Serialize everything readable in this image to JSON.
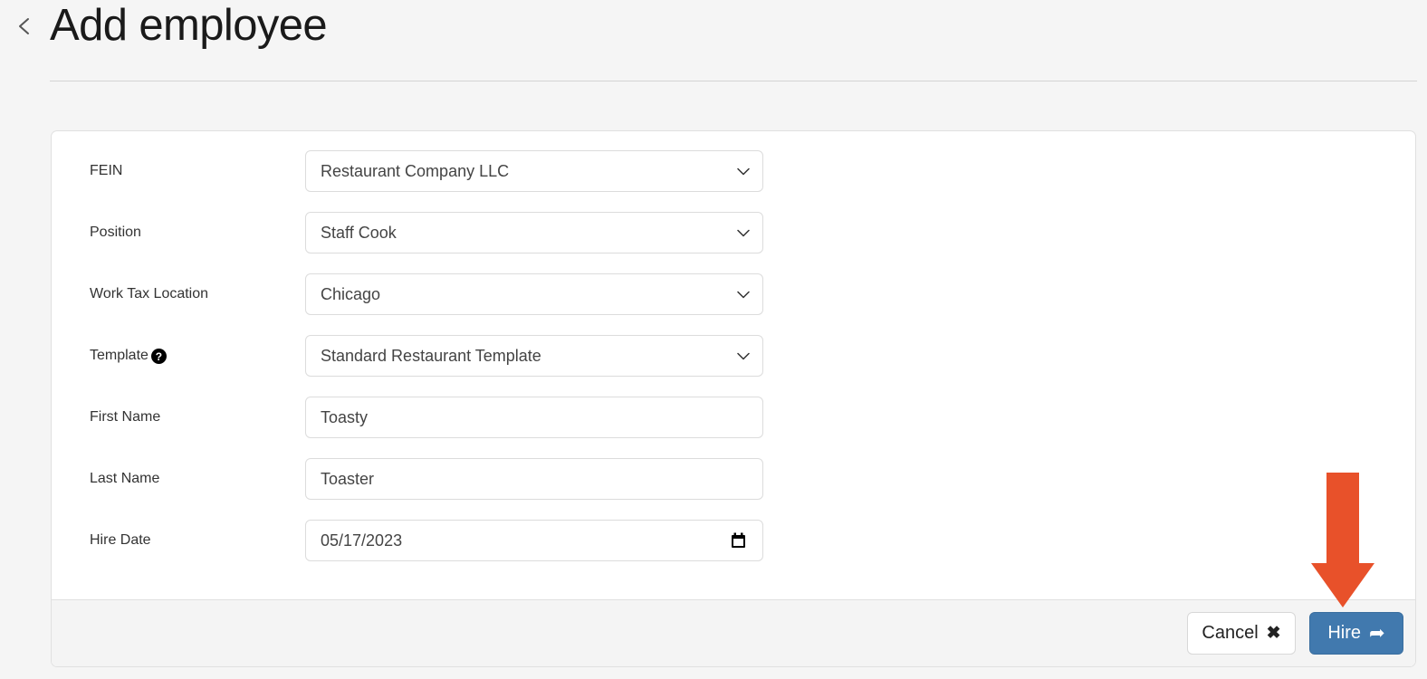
{
  "header": {
    "back_icon": "chevron-left-icon",
    "title": "Add employee"
  },
  "form": {
    "rows": [
      {
        "label": "FEIN",
        "value": "Restaurant Company LLC",
        "type": "select",
        "icon": "chevron-down-icon",
        "help": null
      },
      {
        "label": "Position",
        "value": "Staff Cook",
        "type": "select",
        "icon": "chevron-down-icon",
        "help": null
      },
      {
        "label": "Work Tax Location",
        "value": "Chicago",
        "type": "select",
        "icon": "chevron-down-icon",
        "help": null
      },
      {
        "label": "Template",
        "value": "Standard Restaurant Template",
        "type": "select",
        "icon": "chevron-down-icon",
        "help": "?"
      },
      {
        "label": "First Name",
        "value": "Toasty",
        "type": "text",
        "icon": null,
        "help": null
      },
      {
        "label": "Last Name",
        "value": "Toaster",
        "type": "text",
        "icon": null,
        "help": null
      },
      {
        "label": "Hire Date",
        "value": "05/17/2023",
        "type": "date",
        "icon": "calendar-icon",
        "help": null
      }
    ]
  },
  "footer": {
    "cancel_label": "Cancel",
    "cancel_glyph": "✖",
    "cancel_icon": "close-x-icon",
    "hire_label": "Hire",
    "hire_glyph": "➦",
    "hire_icon": "arrow-forward-icon"
  },
  "annotation": {
    "icon": "arrow-down-annotation",
    "color": "#e8512a",
    "points_at": "hire-button"
  },
  "colors": {
    "page_background": "#f5f5f5",
    "card_background": "#ffffff",
    "card_border": "#e0e0e0",
    "footer_background": "#f4f4f4",
    "primary_button": "#4179ae",
    "text": "#333333",
    "field_text": "#444444",
    "annotation": "#e8512a"
  }
}
